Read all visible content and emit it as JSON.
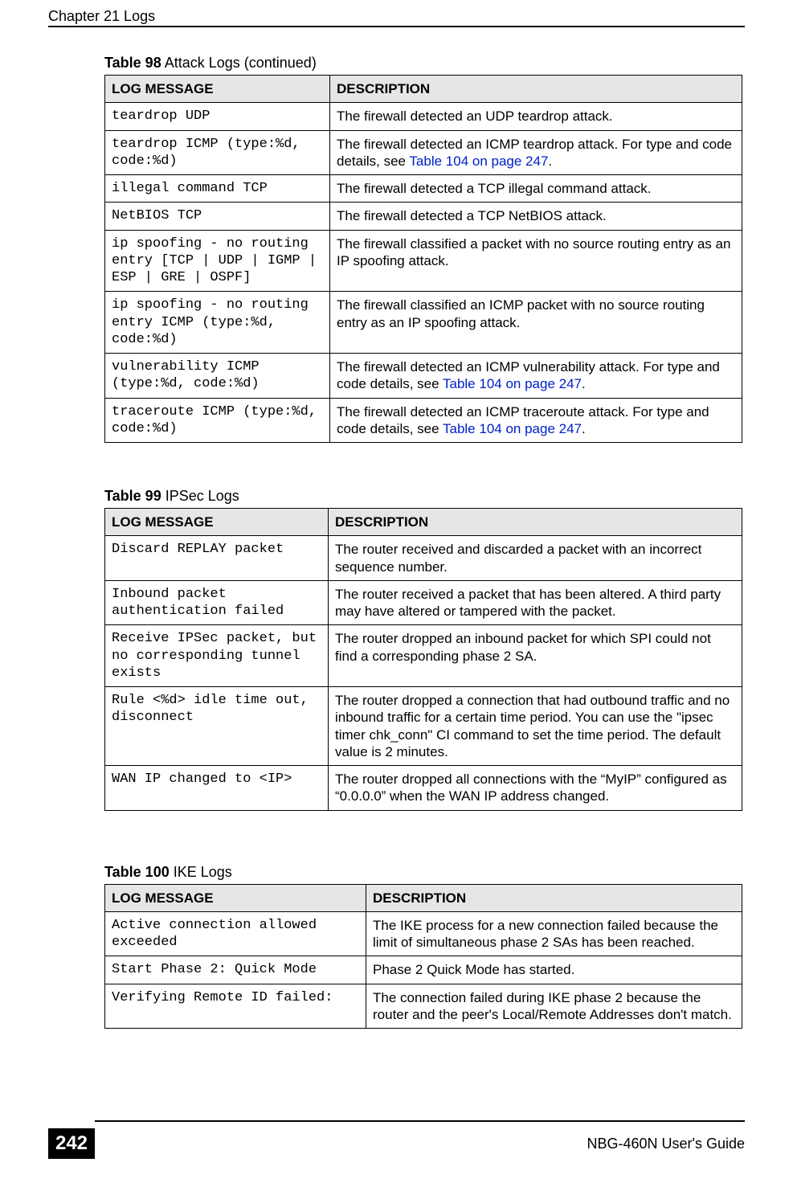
{
  "header": {
    "chapter": "Chapter 21 Logs"
  },
  "footer": {
    "page": "242",
    "guide": "NBG-460N User's Guide"
  },
  "table98": {
    "caption_label": "Table 98",
    "caption_text": "   Attack Logs (continued)",
    "col1": "LOG MESSAGE",
    "col2": "DESCRIPTION",
    "rows": [
      {
        "msg": "teardrop UDP",
        "desc_pre": "The firewall detected an UDP teardrop attack.",
        "link": "",
        "desc_post": ""
      },
      {
        "msg": "teardrop ICMP (type:%d, code:%d)",
        "desc_pre": "The firewall detected an ICMP teardrop attack. For type and code details, see ",
        "link": "Table 104 on page 247",
        "desc_post": "."
      },
      {
        "msg": "illegal command TCP",
        "desc_pre": "The firewall detected a TCP illegal command attack.",
        "link": "",
        "desc_post": ""
      },
      {
        "msg": "NetBIOS TCP",
        "desc_pre": "The firewall detected a TCP NetBIOS attack.",
        "link": "",
        "desc_post": ""
      },
      {
        "msg": "ip spoofing - no routing entry [TCP | UDP | IGMP | ESP | GRE | OSPF]",
        "desc_pre": "The firewall classified a packet with no source routing entry as an IP spoofing attack.",
        "link": "",
        "desc_post": ""
      },
      {
        "msg": "ip spoofing - no routing entry ICMP (type:%d, code:%d)",
        "desc_pre": "The firewall classified an ICMP packet with no source routing entry as an IP spoofing attack.",
        "link": "",
        "desc_post": ""
      },
      {
        "msg": "vulnerability ICMP (type:%d, code:%d)",
        "desc_pre": "The firewall detected an ICMP vulnerability attack. For type and code details, see ",
        "link": "Table 104 on page 247",
        "desc_post": "."
      },
      {
        "msg": "traceroute ICMP (type:%d, code:%d)",
        "desc_pre": "The firewall detected an ICMP traceroute attack. For type and code details, see ",
        "link": "Table 104 on page 247",
        "desc_post": "."
      }
    ]
  },
  "table99": {
    "caption_label": "Table 99",
    "caption_text": "   IPSec Logs",
    "col1": "LOG MESSAGE",
    "col2": "DESCRIPTION",
    "rows": [
      {
        "msg": "Discard REPLAY packet",
        "desc": "The router received and discarded a packet with an incorrect sequence number."
      },
      {
        "msg": "Inbound packet authentication failed",
        "desc": "The router received a packet that has been altered. A third party may have altered or tampered with the packet."
      },
      {
        "msg": "Receive IPSec packet, but no corresponding tunnel exists",
        "desc": "The router dropped an inbound packet for which SPI could not find a corresponding phase 2 SA."
      },
      {
        "msg": "Rule <%d> idle time out, disconnect",
        "desc": "The router dropped a connection that had outbound traffic and no inbound traffic for a certain time period. You can use the \"ipsec timer chk_conn\" CI command to set the time period. The default value is 2 minutes."
      },
      {
        "msg": "WAN IP changed to <IP>",
        "desc": "The router dropped all connections with the “MyIP” configured as “0.0.0.0” when the WAN IP address changed."
      }
    ]
  },
  "table100": {
    "caption_label": "Table 100",
    "caption_text": "   IKE Logs",
    "col1": "LOG MESSAGE",
    "col2": "DESCRIPTION",
    "rows": [
      {
        "msg": "Active connection allowed exceeded",
        "desc": "The IKE process for a new connection failed because the limit of simultaneous phase 2 SAs has been reached."
      },
      {
        "msg": "Start Phase 2: Quick Mode",
        "desc": "Phase 2 Quick Mode has started."
      },
      {
        "msg": "Verifying Remote ID failed:",
        "desc": "The connection failed during IKE phase 2 because the router and the peer's Local/Remote Addresses don't match."
      }
    ]
  }
}
